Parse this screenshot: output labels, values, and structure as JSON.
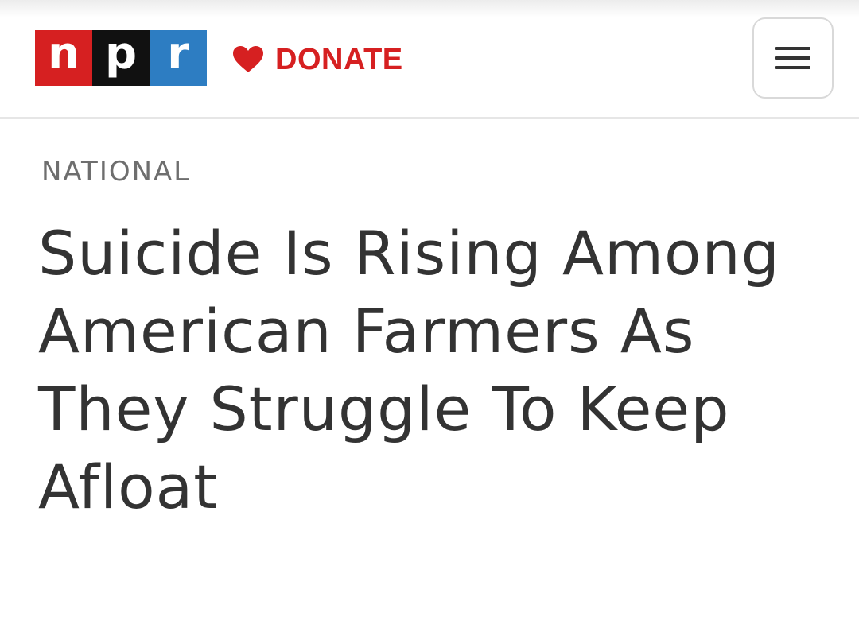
{
  "header": {
    "logo": {
      "letters": [
        "n",
        "p",
        "r"
      ],
      "colors": [
        "#d62021",
        "#111111",
        "#2d7dc2"
      ]
    },
    "donate": {
      "icon": "heart-icon",
      "label": "DONATE",
      "color": "#d62021"
    },
    "menu": {
      "icon": "hamburger-menu-icon"
    }
  },
  "article": {
    "section": "NATIONAL",
    "headline": "Suicide Is Rising Among American Farmers As They Struggle To Keep Afloat"
  }
}
